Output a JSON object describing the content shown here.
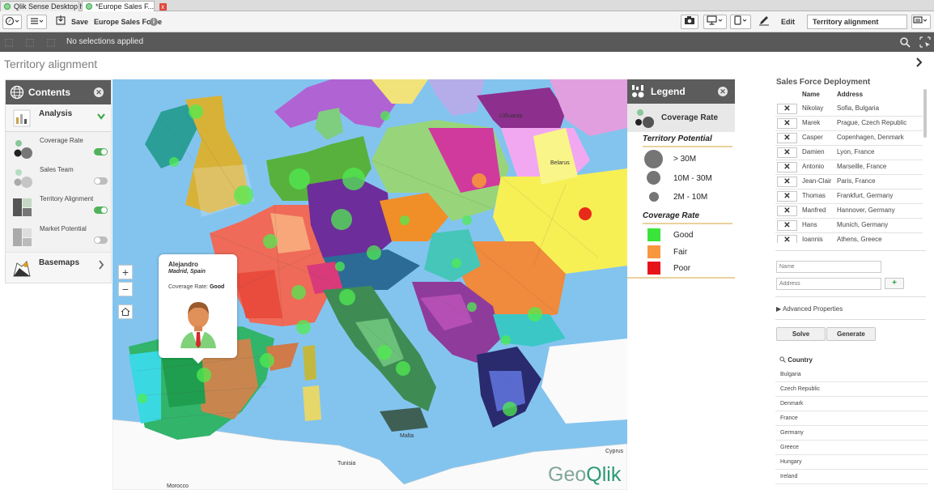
{
  "browser_tabs": [
    {
      "label": "Qlik Sense Desktop hub"
    },
    {
      "label": "*Europe Sales F...",
      "close": "x"
    }
  ],
  "toolbar": {
    "save_label": "Save",
    "app_title": "Europe Sales Force",
    "edit_label": "Edit",
    "sheet_select": "Territory alignment"
  },
  "selections": {
    "text": "No selections applied"
  },
  "sheet": {
    "title": "Territory alignment"
  },
  "contents_panel": {
    "title": "Contents",
    "analysis_label": "Analysis",
    "layers": [
      {
        "name": "Coverage Rate",
        "on": true
      },
      {
        "name": "Sales Team",
        "on": false
      },
      {
        "name": "Territory Alignment",
        "on": true
      },
      {
        "name": "Market Potential",
        "on": false
      }
    ],
    "basemaps_label": "Basemaps"
  },
  "zoom": {
    "plus": "+",
    "minus": "−"
  },
  "tooltip": {
    "name": "Alejandro",
    "location": "Madrid, Spain",
    "rate_label": "Coverage Rate:",
    "rate_value": "Good"
  },
  "map_labels": {
    "watermark_a": "Geo",
    "watermark_b": "Qlik",
    "places": [
      {
        "name": "Lithuania"
      },
      {
        "name": "Belarus"
      },
      {
        "name": "Malta"
      },
      {
        "name": "Tunisia"
      },
      {
        "name": "Morocco"
      },
      {
        "name": "Cyprus"
      }
    ]
  },
  "legend": {
    "title": "Legend",
    "subtitle": "Coverage Rate",
    "potential_heading": "Territory Potential",
    "potential_rows": [
      {
        "label": "> 30M"
      },
      {
        "label": "10M - 30M"
      },
      {
        "label": "2M - 10M"
      }
    ],
    "rate_heading": "Coverage Rate",
    "rate_rows": [
      {
        "label": "Good",
        "color": "#3be43b"
      },
      {
        "label": "Fair",
        "color": "#f7983f"
      },
      {
        "label": "Poor",
        "color": "#e6141a"
      }
    ]
  },
  "deployment": {
    "title": "Sales Force Deployment",
    "col_name": "Name",
    "col_address": "Address",
    "rows": [
      {
        "name": "Nikolay",
        "address": "Sofia, Bulgaria"
      },
      {
        "name": "Marek",
        "address": "Prague, Czech Republic"
      },
      {
        "name": "Casper",
        "address": "Copenhagen, Denmark"
      },
      {
        "name": "Damien",
        "address": "Lyon, France"
      },
      {
        "name": "Antonio",
        "address": "Marseille, France"
      },
      {
        "name": "Jean-Clair",
        "address": "Paris, France"
      },
      {
        "name": "Thomas",
        "address": "Frankfurt, Germany"
      },
      {
        "name": "Manfred",
        "address": "Hannover, Germany"
      },
      {
        "name": "Hans",
        "address": "Munich, Germany"
      },
      {
        "name": "Ioannis",
        "address": "Athens, Greece"
      }
    ],
    "remove_glyph": "✕",
    "name_placeholder": "Name",
    "address_placeholder": "Address",
    "add_glyph": "+",
    "advanced_label": "Advanced Properties",
    "solve_label": "Solve",
    "generate_label": "Generate",
    "country_heading": "Country",
    "countries": [
      "Bulgaria",
      "Czech Republic",
      "Denmark",
      "France",
      "Germany",
      "Greece",
      "Hungary",
      "Ireland"
    ]
  }
}
